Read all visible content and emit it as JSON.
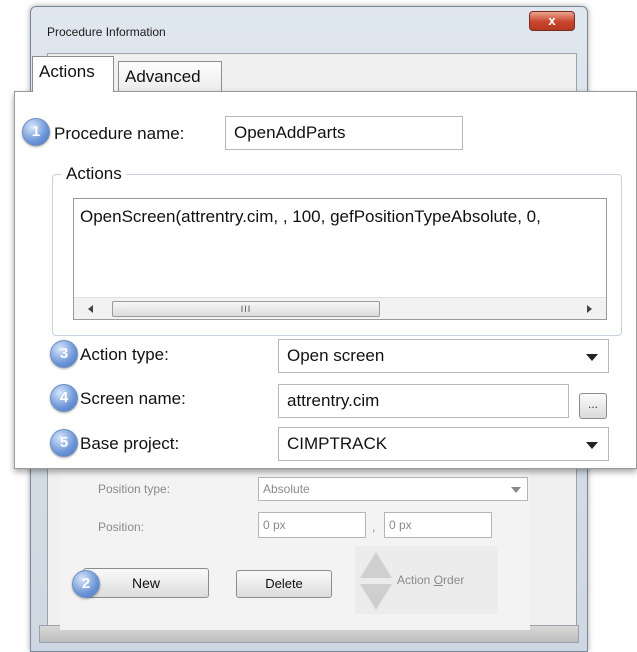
{
  "dialog": {
    "title": "Procedure Information",
    "close_label": "x"
  },
  "tabs": [
    {
      "label": "Actions",
      "active": true
    },
    {
      "label": "Advanced",
      "active": false
    }
  ],
  "callouts": [
    "1",
    "2",
    "3",
    "4",
    "5"
  ],
  "procedure": {
    "name_label": "Procedure name:",
    "name_value": "OpenAddParts"
  },
  "actions_group": {
    "title": "Actions",
    "list_text": "OpenScreen(attrentry.cim, , 100, gefPositionTypeAbsolute, 0,",
    "scroll_thumb_grip": "III"
  },
  "action_type": {
    "label": "Action type:",
    "value": "Open screen"
  },
  "screen_name": {
    "label": "Screen name:",
    "value": "attrentry.cim",
    "browse_label": "..."
  },
  "base_project": {
    "label": "Base project:",
    "value": "CIMPTRACK"
  },
  "position": {
    "type_label": "Position type:",
    "type_value": "Absolute",
    "label": "Position:",
    "x_value": "0 px",
    "separator": ",",
    "y_value": "0 px"
  },
  "buttons": {
    "new": "New",
    "delete": "Delete",
    "action_order_prefix": "Action ",
    "action_order_underlined": "O",
    "action_order_suffix": "rder"
  },
  "colors": {
    "callout": "#6b95d6",
    "close_button": "#c9452c",
    "dim_text": "#8a8a8a"
  }
}
